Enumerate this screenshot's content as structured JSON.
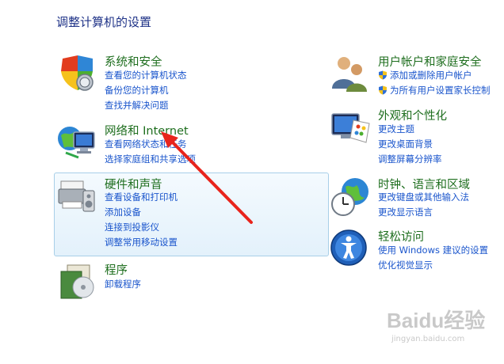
{
  "page_title": "调整计算机的设置",
  "left_categories": [
    {
      "title": "系统和安全",
      "links": [
        "查看您的计算机状态",
        "备份您的计算机",
        "查找并解决问题"
      ]
    },
    {
      "title": "网络和 Internet",
      "links": [
        "查看网络状态和任务",
        "选择家庭组和共享选项"
      ]
    },
    {
      "title": "硬件和声音",
      "links": [
        "查看设备和打印机",
        "添加设备",
        "连接到投影仪",
        "调整常用移动设置"
      ]
    },
    {
      "title": "程序",
      "links": [
        "卸载程序"
      ]
    }
  ],
  "right_categories": [
    {
      "title": "用户帐户和家庭安全",
      "links": [
        "添加或删除用户帐户",
        "为所有用户设置家长控制"
      ]
    },
    {
      "title": "外观和个性化",
      "links": [
        "更改主题",
        "更改桌面背景",
        "调整屏幕分辨率"
      ]
    },
    {
      "title": "时钟、语言和区域",
      "links": [
        "更改键盘或其他输入法",
        "更改显示语言"
      ]
    },
    {
      "title": "轻松访问",
      "links": [
        "使用 Windows 建议的设置",
        "优化视觉显示"
      ]
    }
  ],
  "watermark": {
    "logo": "Baidu经验",
    "url": "jingyan.baidu.com"
  },
  "colors": {
    "title_green": "#1e6e1e",
    "link_blue": "#1a55cc",
    "page_title_blue": "#1e3287",
    "annotation_arrow": "#e8241c"
  }
}
